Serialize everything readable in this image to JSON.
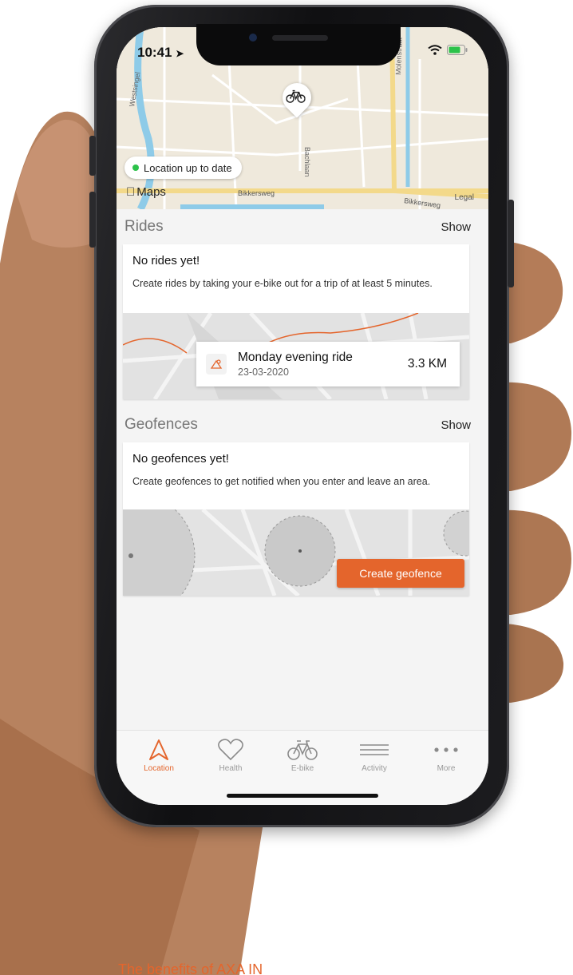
{
  "status_bar": {
    "time": "10:41"
  },
  "map": {
    "location_status": "Location up to date",
    "maps_label": "Maps",
    "legal_label": "Legal",
    "street_labels": [
      "Westsingel",
      "Molenstraat",
      "Bachlaan",
      "Bikkersweg",
      "Bikkersweg"
    ]
  },
  "rides": {
    "title": "Rides",
    "action": "Show",
    "empty_title": "No rides yet!",
    "empty_desc": "Create rides by taking your e-bike out for a trip of at least 5 minutes.",
    "example": {
      "name": "Monday evening ride",
      "date": "23-03-2020",
      "distance": "3.3 KM"
    }
  },
  "geofences": {
    "title": "Geofences",
    "action": "Show",
    "empty_title": "No geofences yet!",
    "empty_desc": "Create geofences to get notified when you enter and leave an area.",
    "create_button": "Create geofence"
  },
  "tabs": [
    {
      "label": "Location",
      "icon": "navigation-arrow-icon",
      "active": true
    },
    {
      "label": "Health",
      "icon": "heart-icon",
      "active": false
    },
    {
      "label": "E-bike",
      "icon": "bicycle-icon",
      "active": false
    },
    {
      "label": "Activity",
      "icon": "list-icon",
      "active": false
    },
    {
      "label": "More",
      "icon": "more-dots-icon",
      "active": false
    }
  ],
  "footer": {
    "heading": "The benefits of AXA IN"
  },
  "colors": {
    "accent": "#e4652c",
    "location_ok": "#2cc24a",
    "map_bg": "#efe9dc"
  }
}
